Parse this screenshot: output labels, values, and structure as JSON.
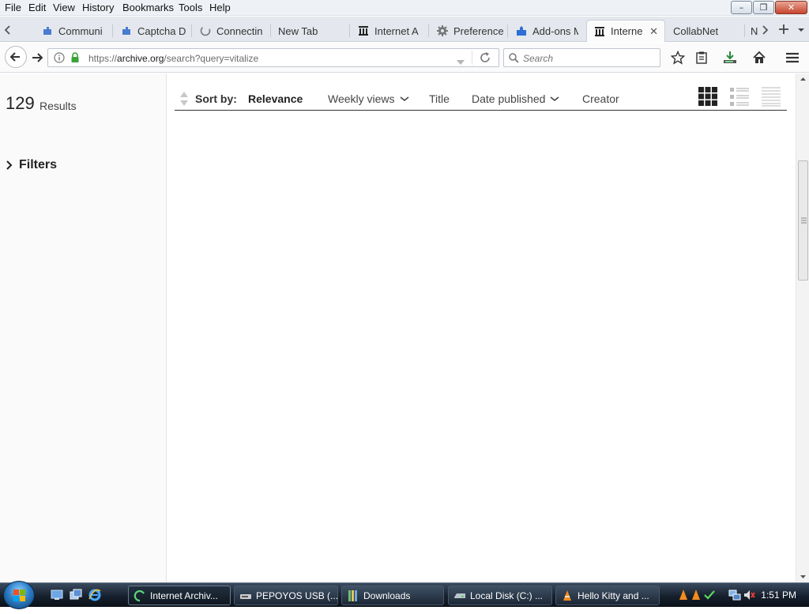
{
  "menubar": {
    "items": [
      "File",
      "Edit",
      "View",
      "History",
      "Bookmarks",
      "Tools",
      "Help"
    ]
  },
  "tabs": [
    {
      "label": "Communi",
      "icon": "puzzle-icon",
      "active": false
    },
    {
      "label": "Captcha D",
      "icon": "puzzle-icon",
      "active": false
    },
    {
      "label": "Connectin",
      "icon": "loading-icon",
      "active": false
    },
    {
      "label": "New Tab",
      "icon": "none",
      "active": false
    },
    {
      "label": "Internet A",
      "icon": "archive-icon",
      "active": false
    },
    {
      "label": "Preference",
      "icon": "gear-icon",
      "active": false
    },
    {
      "label": "Add-ons M",
      "icon": "addon-puzzle-icon",
      "active": false
    },
    {
      "label": "Interne",
      "icon": "archive-icon",
      "active": true
    },
    {
      "label": "CollabNet",
      "icon": "none",
      "active": false
    },
    {
      "label": "N",
      "icon": "none",
      "active": false
    }
  ],
  "urlbar": {
    "prefix": "https://",
    "domain": "archive.org",
    "path": "/search?query=vitalize"
  },
  "search": {
    "placeholder": "Search"
  },
  "sidebar": {
    "results_count": "129",
    "results_label": "Results",
    "filters_label": "Filters"
  },
  "sortbar": {
    "label": "Sort by:",
    "options": [
      "Relevance",
      "Weekly views",
      "Title",
      "Date published",
      "Creator"
    ],
    "active": "Relevance"
  },
  "taskbar": {
    "windows": [
      "Internet Archiv...",
      "PEPOYOS USB (...",
      "Downloads",
      "Local Disk (C:) ...",
      "Hello Kitty and ..."
    ],
    "clock": "1:51 PM"
  },
  "colors": {
    "accent": "#3b6fbf",
    "ssl_lock": "#3aa43a",
    "taskbar": "#16202d"
  }
}
